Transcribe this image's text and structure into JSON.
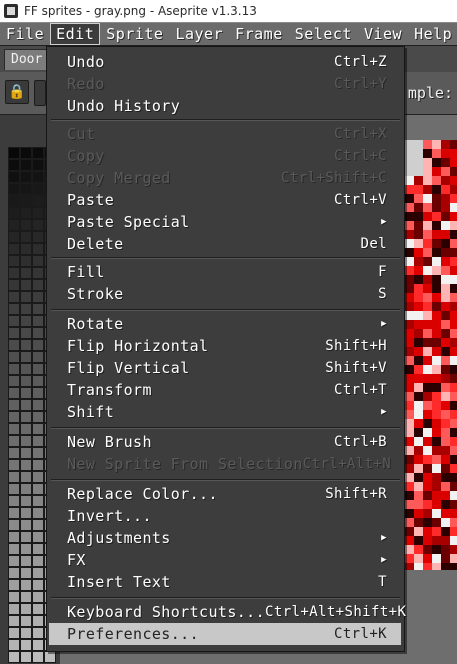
{
  "window": {
    "title": "FF sprites - gray.png - Aseprite v1.3.13"
  },
  "menubar": {
    "items": [
      "File",
      "Edit",
      "Sprite",
      "Layer",
      "Frame",
      "Select",
      "View",
      "Help"
    ],
    "active": "Edit"
  },
  "tabs": [
    {
      "label": "Door"
    }
  ],
  "context_bar": {
    "sample_label": "mple:"
  },
  "edit_menu": [
    {
      "label": "Undo",
      "shortcut": "Ctrl+Z",
      "enabled": true
    },
    {
      "label": "Redo",
      "shortcut": "Ctrl+Y",
      "enabled": false
    },
    {
      "label": "Undo History",
      "shortcut": "",
      "enabled": true
    },
    {
      "label": "Cut",
      "shortcut": "Ctrl+X",
      "enabled": false
    },
    {
      "label": "Copy",
      "shortcut": "Ctrl+C",
      "enabled": false
    },
    {
      "label": "Copy Merged",
      "shortcut": "Ctrl+Shift+C",
      "enabled": false
    },
    {
      "label": "Paste",
      "shortcut": "Ctrl+V",
      "enabled": true
    },
    {
      "label": "Paste Special",
      "shortcut": "",
      "submenu": true,
      "enabled": true
    },
    {
      "label": "Delete",
      "shortcut": "Del",
      "enabled": true
    },
    {
      "label": "Fill",
      "shortcut": "F",
      "enabled": true
    },
    {
      "label": "Stroke",
      "shortcut": "S",
      "enabled": true
    },
    {
      "label": "Rotate",
      "shortcut": "",
      "submenu": true,
      "enabled": true
    },
    {
      "label": "Flip Horizontal",
      "shortcut": "Shift+H",
      "enabled": true
    },
    {
      "label": "Flip Vertical",
      "shortcut": "Shift+V",
      "enabled": true
    },
    {
      "label": "Transform",
      "shortcut": "Ctrl+T",
      "enabled": true
    },
    {
      "label": "Shift",
      "shortcut": "",
      "submenu": true,
      "enabled": true
    },
    {
      "label": "New Brush",
      "shortcut": "Ctrl+B",
      "enabled": true
    },
    {
      "label": "New Sprite From Selection",
      "shortcut": "Ctrl+Alt+N",
      "enabled": false
    },
    {
      "label": "Replace Color...",
      "shortcut": "Shift+R",
      "enabled": true
    },
    {
      "label": "Invert...",
      "shortcut": "",
      "enabled": true
    },
    {
      "label": "Adjustments",
      "shortcut": "",
      "submenu": true,
      "enabled": true
    },
    {
      "label": "FX",
      "shortcut": "",
      "submenu": true,
      "enabled": true
    },
    {
      "label": "Insert Text",
      "shortcut": "T",
      "enabled": true
    },
    {
      "label": "Keyboard Shortcuts...",
      "shortcut": "Ctrl+Alt+Shift+K",
      "enabled": true
    },
    {
      "label": "Preferences...",
      "shortcut": "Ctrl+K",
      "enabled": true,
      "highlighted": true
    }
  ],
  "icons": {
    "app": "aseprite-app-icon",
    "lock": "lock-icon",
    "submenu": "chevron-right-icon"
  },
  "colors": {
    "menu_bg": "#3d3d3d",
    "menubar_bg": "#6b6b6b",
    "highlight_bg": "#c8c8c8",
    "sprite_red": "#d90000"
  }
}
